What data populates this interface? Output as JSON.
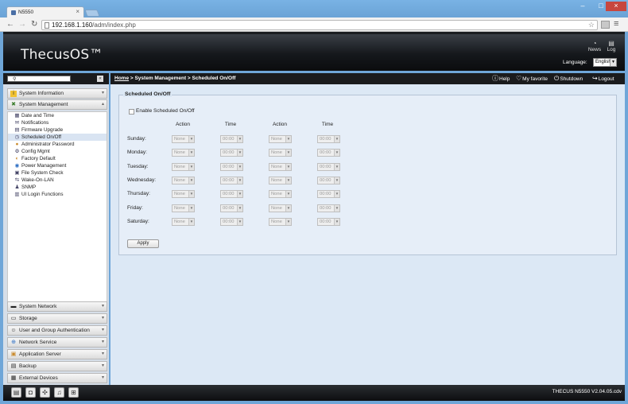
{
  "browser": {
    "tab_title": "N5550",
    "tab_close": "×",
    "url_host": "192.168.1.160",
    "url_path": "/adm/index.php",
    "win_min": "–",
    "win_max": "□",
    "win_close": "×",
    "back": "←",
    "forward": "→",
    "reload": "↻",
    "star": "☆",
    "menu": "≡"
  },
  "header": {
    "logo": "ThecusOS™",
    "news_label": "News",
    "log_label": "Log",
    "language_label": "Language:",
    "language_value": "English"
  },
  "sidebar": {
    "sections_top": [
      {
        "label": "System Information",
        "icon": "i"
      },
      {
        "label": "System Management",
        "icon": "✖"
      }
    ],
    "items": [
      {
        "label": "Date and Time",
        "icon": "▦"
      },
      {
        "label": "Notifications",
        "icon": "✉"
      },
      {
        "label": "Firmware Upgrade",
        "icon": "▤"
      },
      {
        "label": "Scheduled On/Off",
        "icon": "◷"
      },
      {
        "label": "Administrator Password",
        "icon": "●"
      },
      {
        "label": "Config Mgmt",
        "icon": "⚙"
      },
      {
        "label": "Factory Default",
        "icon": "◐"
      },
      {
        "label": "Power Management",
        "icon": "◉"
      },
      {
        "label": "File System Check",
        "icon": "▣"
      },
      {
        "label": "Wake-On-LAN",
        "icon": "⇆"
      },
      {
        "label": "SNMP",
        "icon": "♟"
      },
      {
        "label": "UI Login Functions",
        "icon": "▥"
      }
    ],
    "sections_bottom": [
      {
        "label": "System Network",
        "icon": "▬"
      },
      {
        "label": "Storage",
        "icon": "▭"
      },
      {
        "label": "User and Group Authentication",
        "icon": "☺"
      },
      {
        "label": "Network Service",
        "icon": "⊕"
      },
      {
        "label": "Application Server",
        "icon": "▣"
      },
      {
        "label": "Backup",
        "icon": "▤"
      },
      {
        "label": "External Devices",
        "icon": "▦"
      }
    ]
  },
  "topbar": {
    "crumb_home": "Home",
    "crumb_rest": " > System Management > Scheduled On/Off",
    "help": "Help",
    "favorite": "My favorite",
    "shutdown": "Shutdown",
    "logout": "Logout"
  },
  "schedule": {
    "legend": "Scheduled On/Off",
    "enable_label": "Enable Scheduled On/Off",
    "col_action": "Action",
    "col_time": "Time",
    "days": [
      "Sunday:",
      "Monday:",
      "Tuesday:",
      "Wednesday:",
      "Thursday:",
      "Friday:",
      "Saturday:"
    ],
    "action_value": "None",
    "time_value": "00:00",
    "apply": "Apply"
  },
  "footer": {
    "version": "THECUS N5550 V2.04.05.cdv"
  }
}
